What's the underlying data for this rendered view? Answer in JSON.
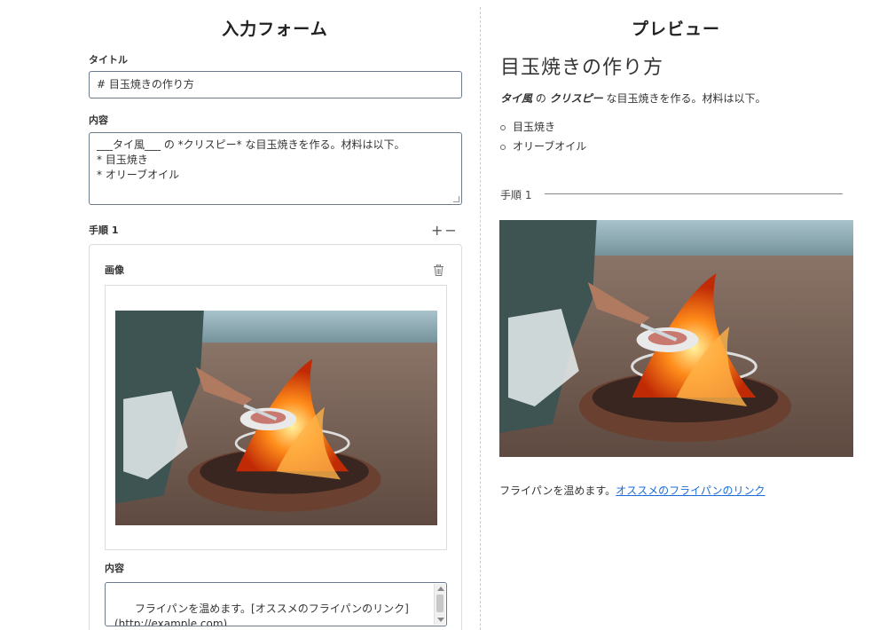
{
  "form": {
    "heading": "入力フォーム",
    "title_label": "タイトル",
    "title_value": "# 目玉焼きの作り方",
    "content_label": "内容",
    "content_value": "___タイ風___ の *クリスピー* な目玉焼きを作る。材料は以下。\n* 目玉焼き\n* オリーブオイル",
    "step_label": "手順 1",
    "step_add_icon": "plus-icon",
    "step_remove_icon": "minus-icon",
    "step": {
      "image_label": "画像",
      "delete_icon": "trash-icon",
      "content_label": "内容",
      "content_value": "フライパンを温めます。[オススメのフライパンのリンク]\n(http://example.com)"
    }
  },
  "preview": {
    "heading": "プレビュー",
    "title": "目玉焼きの作り方",
    "para_em1": "タイ風",
    "para_mid": " の ",
    "para_em2": "クリスピー",
    "para_rest": " な目玉焼きを作る。材料は以下。",
    "list": [
      "目玉焼き",
      "オリーブオイル"
    ],
    "step_label": "手順 1",
    "step_text": "フライパンを温めます。",
    "step_link": "オススメのフライパンのリンク"
  },
  "colors": {
    "link": "#1a6dd8",
    "field_border": "#6b7b8c",
    "divider": "#cccccc"
  }
}
